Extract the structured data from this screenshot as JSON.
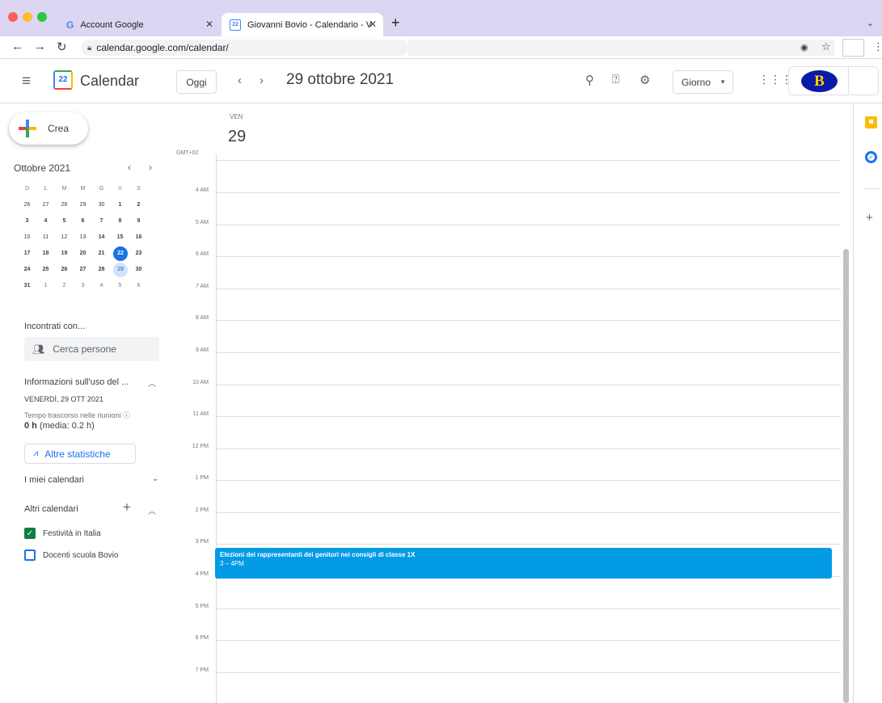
{
  "browser": {
    "tabs": [
      {
        "title": "Account Google",
        "icon": "google-g-icon"
      },
      {
        "title": "Giovanni Bovio - Calendario - V",
        "icon": "calendar-favicon-icon",
        "favicon_text": "22"
      }
    ],
    "url": "calendar.google.com/calendar/",
    "traffic_lights": [
      "#ff5f57",
      "#febc2e",
      "#28c840"
    ]
  },
  "header": {
    "app_title": "Calendar",
    "app_icon_day": "22",
    "today_label": "Oggi",
    "date_title": "29 ottobre 2021",
    "view_select": "Giorno",
    "brand_letter": "B"
  },
  "sidebar": {
    "create_label": "Crea",
    "minimonth": {
      "title": "Ottobre 2021",
      "weekday_headers": [
        "D",
        "L",
        "M",
        "M",
        "G",
        "V",
        "S"
      ],
      "weeks": [
        [
          "26",
          "27",
          "28",
          "29",
          "30",
          "1",
          "2"
        ],
        [
          "3",
          "4",
          "5",
          "6",
          "7",
          "8",
          "9"
        ],
        [
          "10",
          "11",
          "12",
          "13",
          "14",
          "15",
          "16"
        ],
        [
          "17",
          "18",
          "19",
          "20",
          "21",
          "22",
          "23"
        ],
        [
          "24",
          "25",
          "26",
          "27",
          "28",
          "29",
          "30"
        ],
        [
          "31",
          "1",
          "2",
          "3",
          "4",
          "5",
          "6"
        ]
      ],
      "today": "22",
      "selected": "29"
    },
    "meet_heading": "Incontrati con...",
    "meet_placeholder": "Cerca persone",
    "insights": {
      "heading": "Informazioni sull'uso del ...",
      "date": "VENERDÌ, 29 OTT 2021",
      "time_label": "Tempo trascorso nelle riunioni ⓘ",
      "hours_value": "0 h",
      "hours_avg": "(media: 0.2 h)",
      "more_stats": "Altre statistiche"
    },
    "my_calendars": "I miei calendari",
    "other_calendars": "Altri calendari",
    "calendars": [
      {
        "label": "Festività in Italia",
        "checked": true,
        "color": "#0b8043"
      },
      {
        "label": "Docenti scuola Bovio",
        "checked": false,
        "color": "#1a73e8"
      }
    ]
  },
  "day_view": {
    "day_name": "VEN",
    "day_number": "29",
    "timezone": "GMT+02",
    "hours": [
      "4 AM",
      "5 AM",
      "6 AM",
      "7 AM",
      "8 AM",
      "9 AM",
      "10 AM",
      "11 AM",
      "12 PM",
      "1 PM",
      "2 PM",
      "3 PM",
      "4 PM",
      "5 PM",
      "6 PM",
      "7 PM"
    ],
    "event": {
      "title": "Elezioni dei rappresentanti dei genitori nei consigli di classe 1X",
      "time": "3 – 4PM",
      "color": "#039be5"
    }
  },
  "colors": {
    "accent": "#1a73e8",
    "tabbar": "#dcd6f2"
  }
}
